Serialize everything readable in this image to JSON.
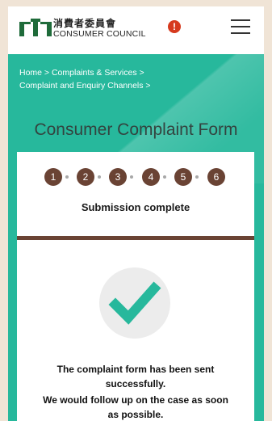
{
  "header": {
    "logo_cn": "消費者委員會",
    "logo_en": "CONSUMER COUNCIL",
    "alert_icon": "alert-icon",
    "menu_icon": "hamburger-menu-icon"
  },
  "breadcrumb": {
    "line1": "Home > Complaints & Services >",
    "line2": "Complaint and Enquiry Channels >"
  },
  "page_title": "Consumer Complaint Form",
  "steps": [
    "1",
    "2",
    "3",
    "4",
    "5",
    "6"
  ],
  "status": "Submission complete",
  "message": {
    "line1": "The complaint form has been sent",
    "line2": "successfully.",
    "line3": "We would follow up on the case as soon",
    "line4": "as possible."
  },
  "colors": {
    "brand_teal": "#27b89c",
    "step_brown": "#6a4334",
    "check_green": "#27b89c",
    "alert_red": "#d63a1e"
  }
}
